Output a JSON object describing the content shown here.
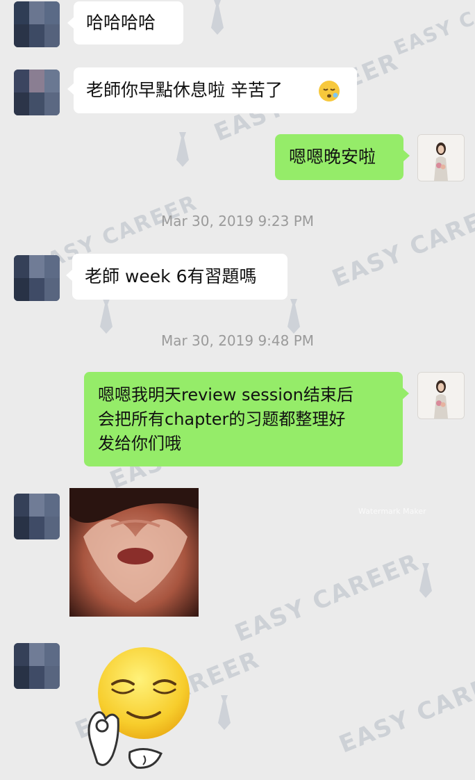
{
  "chat": {
    "messages": [
      {
        "text": "哈哈哈哈"
      },
      {
        "text": "老師你早點休息啦 辛苦了"
      },
      {
        "text": "嗯嗯晚安啦"
      },
      {
        "text": "老師 week 6有習題嗎"
      },
      {
        "lines": [
          "嗯嗯我明天review session结束后",
          "会把所有chapter的习题都整理好",
          "发给你们哦"
        ]
      }
    ],
    "timestamps": [
      "Mar 30, 2019 9:23 PM",
      "Mar 30, 2019 9:48 PM"
    ],
    "emoji": [
      "sleepy-face",
      "relieved-ok-hand-sticker"
    ]
  },
  "watermark": {
    "brand": "EASY CAREER",
    "app": "Watermark Maker"
  },
  "colors": {
    "background": "#ebebeb",
    "incoming_bubble": "#ffffff",
    "outgoing_bubble": "#95ec69",
    "timestamp": "#9a9a9a"
  }
}
